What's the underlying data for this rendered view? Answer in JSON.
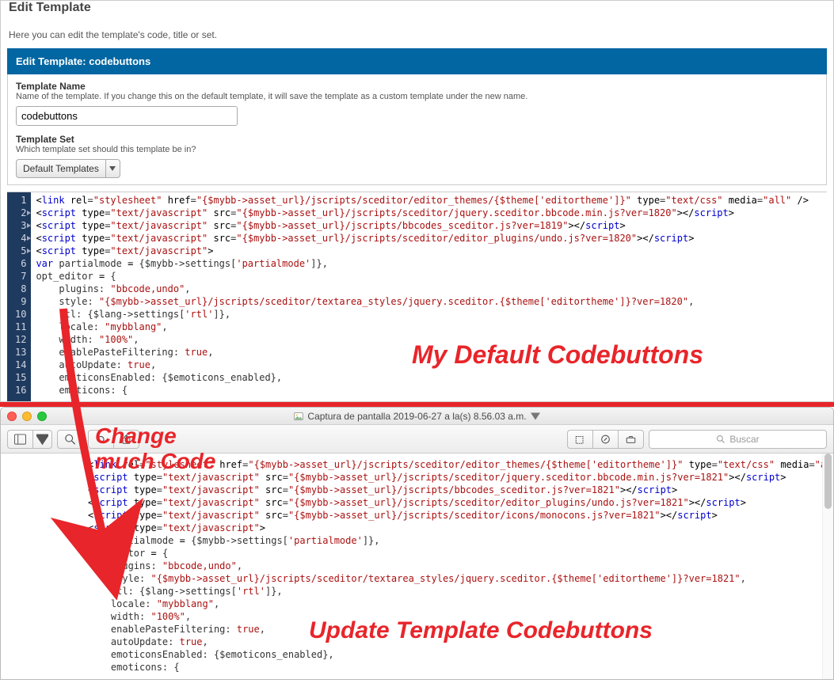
{
  "header": {
    "title": "Edit Template",
    "intro": "Here you can edit the template's code, title or set."
  },
  "panel": {
    "heading_prefix": "Edit Template: ",
    "heading_name": "codebuttons",
    "name_label": "Template Name",
    "name_desc": "Name of the template. If you change this on the default template, it will save the template as a custom template under the new name.",
    "name_value": "codebuttons",
    "set_label": "Template Set",
    "set_desc": "Which template set should this template be in?",
    "set_value": "Default Templates"
  },
  "code_lines": [
    {
      "n": 1,
      "fold": false,
      "html": "<span class='tok-punc'>&lt;</span><span class='tok-tag'>link</span> <span class='tok-attr'>rel</span>=<span class='tok-str'>\"stylesheet\"</span> <span class='tok-attr'>href</span>=<span class='tok-str'>\"{$mybb-&gt;asset_url}/jscripts/sceditor/editor_themes/{$theme['editortheme']}\"</span> <span class='tok-attr'>type</span>=<span class='tok-str'>\"text/css\"</span> <span class='tok-attr'>media</span>=<span class='tok-str'>\"all\"</span> <span class='tok-punc'>/&gt;</span>"
    },
    {
      "n": 2,
      "fold": true,
      "html": "<span class='tok-punc'>&lt;</span><span class='tok-tag'>script</span> <span class='tok-attr'>type</span>=<span class='tok-str'>\"text/javascript\"</span> <span class='tok-attr'>src</span>=<span class='tok-str'>\"{$mybb-&gt;asset_url}/jscripts/sceditor/jquery.sceditor.bbcode.min.js?ver=1820\"</span><span class='tok-punc'>&gt;&lt;/</span><span class='tok-tag'>script</span><span class='tok-punc'>&gt;</span>"
    },
    {
      "n": 3,
      "fold": true,
      "html": "<span class='tok-punc'>&lt;</span><span class='tok-tag'>script</span> <span class='tok-attr'>type</span>=<span class='tok-str'>\"text/javascript\"</span> <span class='tok-attr'>src</span>=<span class='tok-str'>\"{$mybb-&gt;asset_url}/jscripts/bbcodes_sceditor.js?ver=1819\"</span><span class='tok-punc'>&gt;&lt;/</span><span class='tok-tag'>script</span><span class='tok-punc'>&gt;</span>"
    },
    {
      "n": 4,
      "fold": true,
      "html": "<span class='tok-punc'>&lt;</span><span class='tok-tag'>script</span> <span class='tok-attr'>type</span>=<span class='tok-str'>\"text/javascript\"</span> <span class='tok-attr'>src</span>=<span class='tok-str'>\"{$mybb-&gt;asset_url}/jscripts/sceditor/editor_plugins/undo.js?ver=1820\"</span><span class='tok-punc'>&gt;&lt;/</span><span class='tok-tag'>script</span><span class='tok-punc'>&gt;</span>"
    },
    {
      "n": 5,
      "fold": true,
      "html": "<span class='tok-punc'>&lt;</span><span class='tok-tag'>script</span> <span class='tok-attr'>type</span>=<span class='tok-str'>\"text/javascript\"</span><span class='tok-punc'>&gt;</span>"
    },
    {
      "n": 6,
      "fold": false,
      "html": "<span class='tok-kw'>var</span> partialmode <span class='tok-op'>=</span> {$mybb-&gt;settings[<span class='tok-str'>'partialmode'</span>]},"
    },
    {
      "n": 7,
      "fold": false,
      "html": "opt_editor <span class='tok-op'>=</span> {"
    },
    {
      "n": 8,
      "fold": false,
      "html": "    plugins: <span class='tok-str'>\"bbcode,undo\"</span>,"
    },
    {
      "n": 9,
      "fold": false,
      "html": "    style: <span class='tok-str'>\"{$mybb-&gt;asset_url}/jscripts/sceditor/textarea_styles/jquery.sceditor.{$theme['editortheme']}?ver=1820\"</span>,"
    },
    {
      "n": 10,
      "fold": false,
      "html": "    rtl: {$lang-&gt;settings[<span class='tok-str'>'rtl'</span>]},"
    },
    {
      "n": 11,
      "fold": false,
      "html": "    locale: <span class='tok-str'>\"mybblang\"</span>,"
    },
    {
      "n": 12,
      "fold": false,
      "html": "    width: <span class='tok-str'>\"100%\"</span>,"
    },
    {
      "n": 13,
      "fold": false,
      "html": "    enablePasteFiltering: <span class='tok-bool'>true</span>,"
    },
    {
      "n": 14,
      "fold": false,
      "html": "    autoUpdate: <span class='tok-bool'>true</span>,"
    },
    {
      "n": 15,
      "fold": false,
      "html": "    emoticonsEnabled: {$emoticons_enabled},"
    },
    {
      "n": 16,
      "fold": false,
      "html": "    emoticons: {"
    }
  ],
  "mac_window": {
    "title": "Captura de pantalla 2019-06-27 a la(s) 8.56.03 a.m.",
    "search_placeholder": "Buscar"
  },
  "mac_code_lines": [
    "<span class='tok-punc'>&lt;</span><span class='tok-tag'>link</span> <span class='tok-attr'>rel</span>=<span class='tok-str'>\"stylesheet\"</span> <span class='tok-attr'>href</span>=<span class='tok-str'>\"{$mybb-&gt;asset_url}/jscripts/sceditor/editor_themes/{$theme['editortheme']}\"</span> <span class='tok-attr'>type</span>=<span class='tok-str'>\"text/css\"</span> <span class='tok-attr'>media</span>=<span class='tok-str'>\"all\"</span> <span class='tok-punc'>/&gt;</span>",
    "<span class='tok-punc'>&lt;</span><span class='tok-tag'>script</span> <span class='tok-attr'>type</span>=<span class='tok-str'>\"text/javascript\"</span> <span class='tok-attr'>src</span>=<span class='tok-str'>\"{$mybb-&gt;asset_url}/jscripts/sceditor/jquery.sceditor.bbcode.min.js?ver=1821\"</span><span class='tok-punc'>&gt;&lt;/</span><span class='tok-tag'>script</span><span class='tok-punc'>&gt;</span>",
    "<span class='tok-punc'>&lt;</span><span class='tok-tag'>script</span> <span class='tok-attr'>type</span>=<span class='tok-str'>\"text/javascript\"</span> <span class='tok-attr'>src</span>=<span class='tok-str'>\"{$mybb-&gt;asset_url}/jscripts/bbcodes_sceditor.js?ver=1821\"</span><span class='tok-punc'>&gt;&lt;/</span><span class='tok-tag'>script</span><span class='tok-punc'>&gt;</span>",
    "<span class='tok-punc'>&lt;</span><span class='tok-tag'>script</span> <span class='tok-attr'>type</span>=<span class='tok-str'>\"text/javascript\"</span> <span class='tok-attr'>src</span>=<span class='tok-str'>\"{$mybb-&gt;asset_url}/jscripts/sceditor/editor_plugins/undo.js?ver=1821\"</span><span class='tok-punc'>&gt;&lt;/</span><span class='tok-tag'>script</span><span class='tok-punc'>&gt;</span>",
    "<span class='tok-punc'>&lt;</span><span class='tok-tag'>script</span> <span class='tok-attr'>type</span>=<span class='tok-str'>\"text/javascript\"</span> <span class='tok-attr'>src</span>=<span class='tok-str'>\"{$mybb-&gt;asset_url}/jscripts/sceditor/icons/monocons.js?ver=1821\"</span><span class='tok-punc'>&gt;&lt;/</span><span class='tok-tag'>script</span><span class='tok-punc'>&gt;</span>",
    "<span class='tok-punc'>&lt;</span><span class='tok-tag'>script</span> <span class='tok-attr'>type</span>=<span class='tok-str'>\"text/javascript\"</span><span class='tok-punc'>&gt;</span>",
    "<span class='tok-kw'>var</span> partialmode <span class='tok-op'>=</span> {$mybb-&gt;settings[<span class='tok-str'>'partialmode'</span>]},",
    "opt_editor <span class='tok-op'>=</span> {",
    "    plugins: <span class='tok-str'>\"bbcode,undo\"</span>,",
    "    style: <span class='tok-str'>\"{$mybb-&gt;asset_url}/jscripts/sceditor/textarea_styles/jquery.sceditor.{$theme['editortheme']}?ver=1821\"</span>,",
    "    rtl: {$lang-&gt;settings[<span class='tok-str'>'rtl'</span>]},",
    "    locale: <span class='tok-str'>\"mybblang\"</span>,",
    "    width: <span class='tok-str'>\"100%\"</span>,",
    "    enablePasteFiltering: <span class='tok-bool'>true</span>,",
    "    autoUpdate: <span class='tok-bool'>true</span>,",
    "    emoticonsEnabled: {$emoticons_enabled},",
    "    emoticons: {"
  ],
  "annotations": {
    "a1": "My Default Codebuttons",
    "a2": "Change\nmuch Code",
    "a3": "Update Template Codebuttons"
  }
}
